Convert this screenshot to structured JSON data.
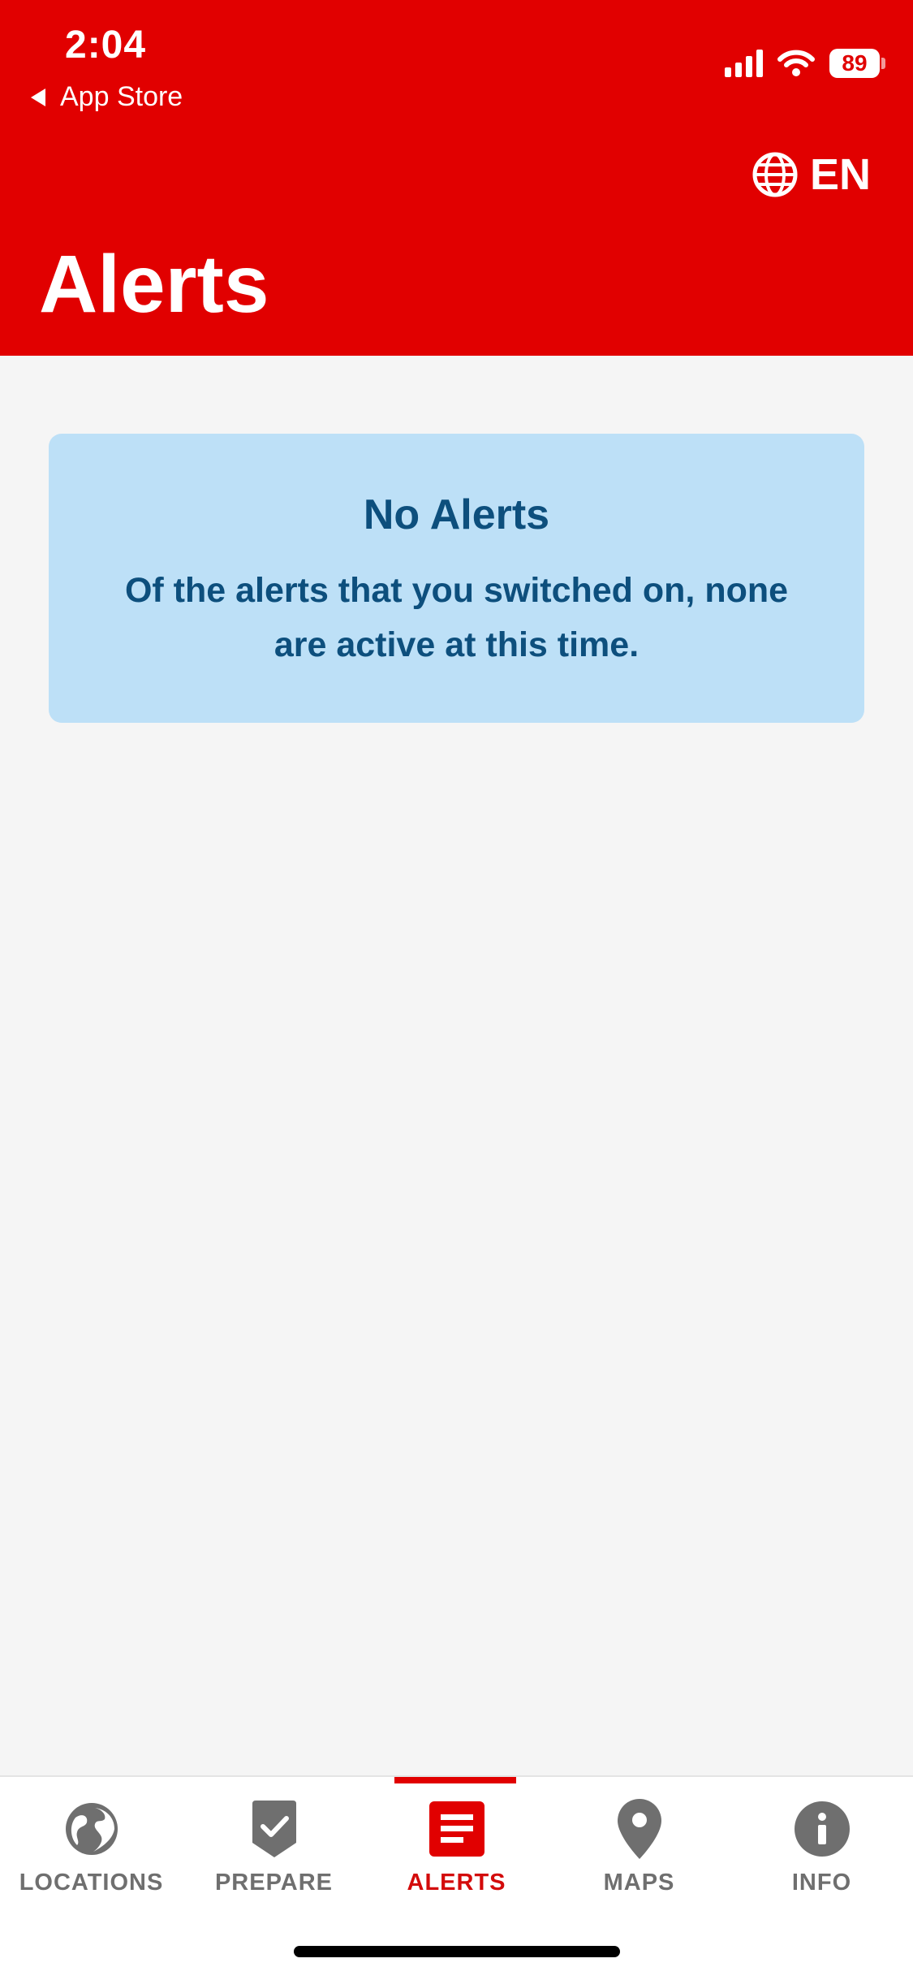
{
  "status_bar": {
    "time": "2:04",
    "back_label": "App Store",
    "battery": "89"
  },
  "header": {
    "language": "EN",
    "title": "Alerts"
  },
  "alert_card": {
    "title": "No Alerts",
    "message": "Of the alerts that you switched on, none are active at this time."
  },
  "tabs": [
    {
      "label": "LOCATIONS",
      "icon": "globe-icon",
      "active": false
    },
    {
      "label": "PREPARE",
      "icon": "checklist-badge-icon",
      "active": false
    },
    {
      "label": "ALERTS",
      "icon": "alerts-list-icon",
      "active": true
    },
    {
      "label": "MAPS",
      "icon": "map-pin-icon",
      "active": false
    },
    {
      "label": "INFO",
      "icon": "info-icon",
      "active": false
    }
  ],
  "colors": {
    "header_red": "#e10000",
    "active_tab": "#d30b0b",
    "inactive_tab": "#6f6f6f",
    "card_bg": "#bde0f7",
    "card_text": "#0d4f7d",
    "page_bg": "#f5f5f5"
  }
}
